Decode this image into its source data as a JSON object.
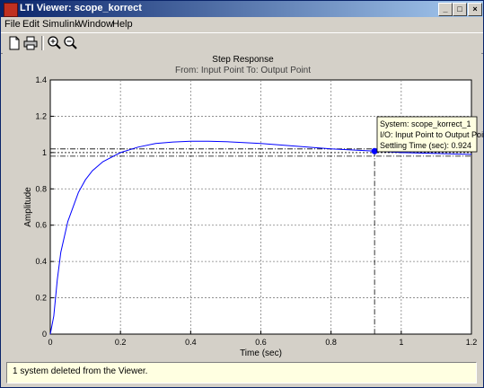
{
  "window": {
    "title": "LTI Viewer: scope_korrect"
  },
  "menu": {
    "items": [
      "File",
      "Edit",
      "Simulink",
      "Window",
      "Help"
    ]
  },
  "toolbar": {
    "icons": [
      "new-icon",
      "print-icon",
      "zoom-in-icon",
      "zoom-out-icon"
    ]
  },
  "plot": {
    "title": "Step Response",
    "subtitle": "From: Input Point  To: Output Point",
    "ylabel": "Amplitude",
    "xlabel": "Time (sec)"
  },
  "datatip": {
    "line1": "System: scope_korrect_1",
    "line2": "I/O: Input Point to Output Point",
    "line3": "Settling Time (sec): 0.924"
  },
  "status": {
    "message": "1 system deleted from the Viewer."
  },
  "chart_data": {
    "type": "line",
    "title": "Step Response",
    "subtitle": "From: Input Point  To: Output Point",
    "xlabel": "Time (sec)",
    "ylabel": "Amplitude",
    "xlim": [
      0,
      1.2
    ],
    "ylim": [
      0,
      1.4
    ],
    "xticks": [
      "0",
      "0.2",
      "0.4",
      "0.6",
      "0.8",
      "1",
      "1.2"
    ],
    "yticks": [
      "0",
      "0.2",
      "0.4",
      "0.6",
      "0.8",
      "1",
      "1.2",
      "1.4"
    ],
    "grid": true,
    "series": [
      {
        "name": "scope_korrect_1",
        "color": "#0000ff",
        "x": [
          0,
          0.01,
          0.02,
          0.03,
          0.05,
          0.08,
          0.1,
          0.12,
          0.15,
          0.2,
          0.25,
          0.3,
          0.35,
          0.4,
          0.45,
          0.5,
          0.6,
          0.7,
          0.8,
          0.9,
          0.924,
          1.0,
          1.1,
          1.2
        ],
        "y": [
          0,
          0.1,
          0.3,
          0.45,
          0.62,
          0.78,
          0.85,
          0.9,
          0.95,
          1.0,
          1.03,
          1.05,
          1.058,
          1.062,
          1.062,
          1.06,
          1.05,
          1.035,
          1.02,
          1.01,
          1.008,
          1.0,
          0.995,
          0.99
        ]
      }
    ],
    "settling_band": {
      "upper": 1.02,
      "lower": 0.98,
      "final": 1.0
    },
    "settling_time": 0.924,
    "settling_value": 1.008
  }
}
